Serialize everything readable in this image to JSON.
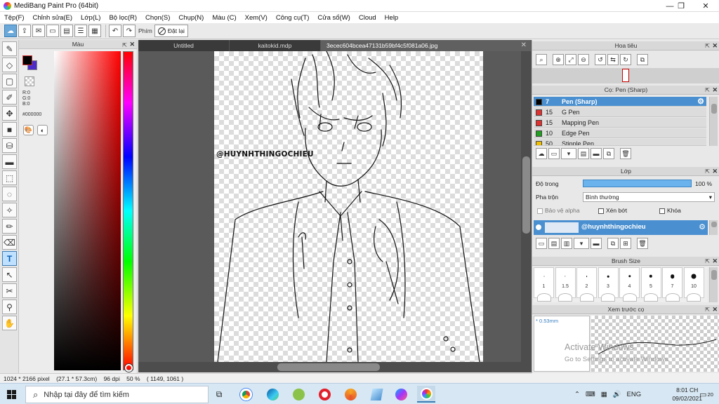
{
  "window": {
    "title": "MediBang Paint Pro (64bit)",
    "controls": {
      "minimize": "—",
      "maximize": "❐",
      "close": "✕"
    }
  },
  "menu": [
    "Tệp(F)",
    "Chỉnh sửa(E)",
    "Lớp(L)",
    "Bộ lọc(R)",
    "Chọn(S)",
    "Chụp(N)",
    "Màu (C)",
    "Xem(V)",
    "Công cụ(T)",
    "Cửa sổ(W)",
    "Cloud",
    "Help"
  ],
  "toolbar": {
    "phim_label": "Phím",
    "reset_label": "Đặt lại"
  },
  "color_panel": {
    "title": "Màu",
    "rgb": {
      "r": "R:0",
      "g": "G:0",
      "b": "B:0"
    },
    "hex": "#000000",
    "fg_color": "#000000",
    "bg_color": "#4b2cc8",
    "hue": "red"
  },
  "tabs": [
    {
      "label": "Untitled",
      "active": false,
      "close": ""
    },
    {
      "label": "kaitokid.mdp",
      "active": false,
      "close": ""
    },
    {
      "label": "3ecec604bcea47131b59bf4c5f081a06.jpg",
      "active": true,
      "close": "✕"
    }
  ],
  "canvas": {
    "watermark": "@HUYNHTHINGOCHIEU"
  },
  "status": {
    "size": "1024 * 2166 pixel",
    "physical": "(27.1 * 57.3cm)",
    "dpi": "96 dpi",
    "zoom": "50 %",
    "cursor": "( 1149, 1061 )"
  },
  "navigator": {
    "title": "Hoa tiêu"
  },
  "brush_panel": {
    "title": "Cọ: Pen (Sharp)",
    "items": [
      {
        "size": "7",
        "name": "Pen (Sharp)",
        "color": "#000000",
        "selected": true
      },
      {
        "size": "15",
        "name": "G Pen",
        "color": "#e03030",
        "selected": false
      },
      {
        "size": "15",
        "name": "Mapping Pen",
        "color": "#e03030",
        "selected": false
      },
      {
        "size": "10",
        "name": "Edge Pen",
        "color": "#20a020",
        "selected": false
      },
      {
        "size": "50",
        "name": "Stipple Pen",
        "color": "#f0c000",
        "selected": false
      }
    ]
  },
  "layer_panel": {
    "title": "Lớp",
    "opacity_label": "Độ trong",
    "opacity_value": "100 %",
    "opacity": 1.0,
    "blend_label": "Pha trộn",
    "blend_value": "Bình thường",
    "protect_alpha": "Bảo vệ alpha",
    "clipping": "Xén bớt",
    "lock": "Khóa",
    "layer_name": "@huynhthingochieu"
  },
  "brush_size": {
    "title": "Brush Size",
    "sizes": [
      "1",
      "1.5",
      "2",
      "3",
      "4",
      "5",
      "7",
      "10"
    ]
  },
  "preview": {
    "title": "Xem trước cọ",
    "size_label": "* 0.53mm",
    "activate_title": "Activate Windows",
    "activate_sub": "Go to Settings to activate Windows."
  },
  "taskbar": {
    "search_placeholder": "Nhập tại đây để tìm kiếm",
    "lang": "ENG",
    "time": "8:01 CH",
    "date": "09/02/2021",
    "notif": "20"
  }
}
